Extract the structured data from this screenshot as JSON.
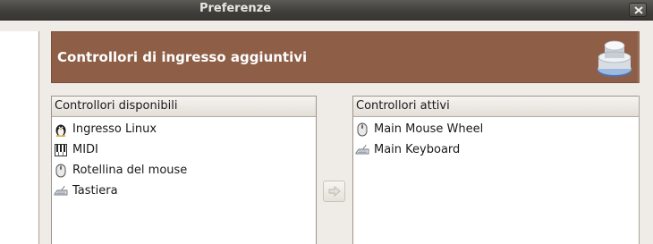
{
  "window": {
    "title": "Preferenze"
  },
  "banner": {
    "title": "Controllori di ingresso aggiuntivi",
    "icon": "joystick-icon"
  },
  "available": {
    "header": "Controllori disponibili",
    "items": [
      {
        "label": "Ingresso Linux",
        "icon": "penguin-icon"
      },
      {
        "label": "MIDI",
        "icon": "midi-piano-icon"
      },
      {
        "label": "Rotellina del mouse",
        "icon": "mouse-icon"
      },
      {
        "label": "Tastiera",
        "icon": "keyboard-icon"
      }
    ]
  },
  "active": {
    "header": "Controllori attivi",
    "items": [
      {
        "label": "Main Mouse Wheel",
        "icon": "mouse-icon"
      },
      {
        "label": "Main Keyboard",
        "icon": "keyboard-icon"
      }
    ]
  },
  "colors": {
    "banner": "#8e5e47",
    "titlebar": "#3f3e3a",
    "window": "#efebe7"
  }
}
